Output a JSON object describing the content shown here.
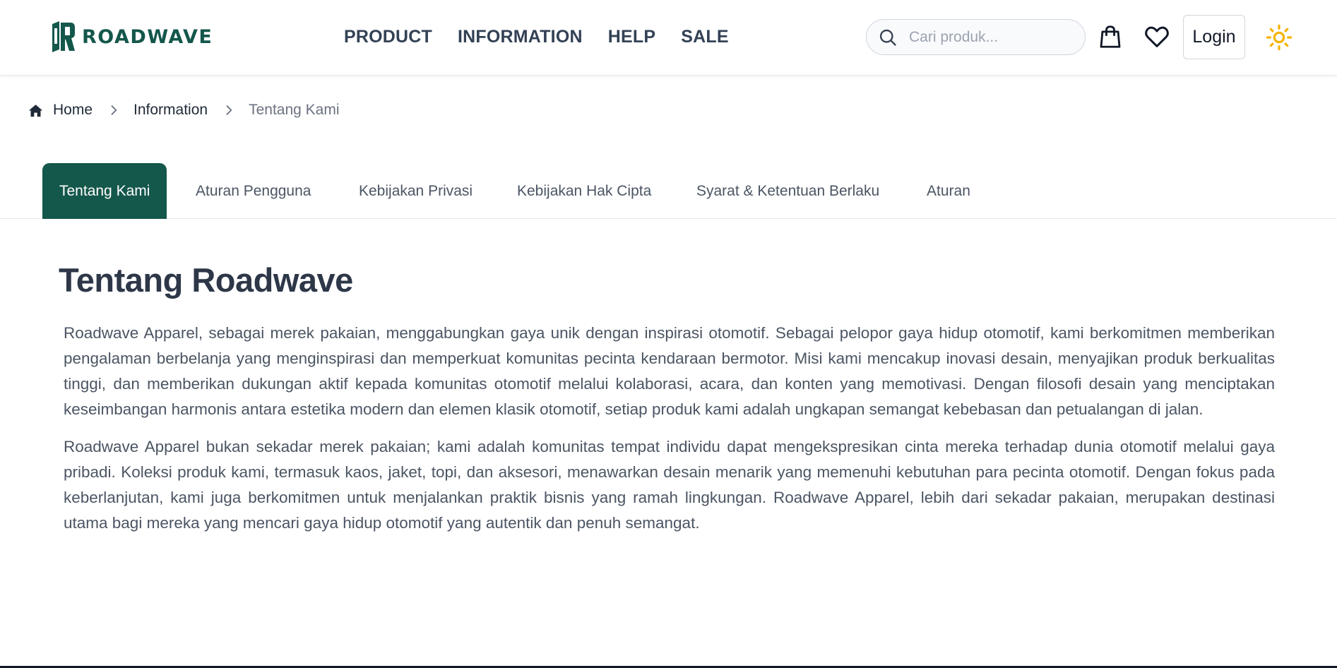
{
  "header": {
    "logo_text": "ROADWAVE",
    "nav": [
      {
        "label": "PRODUCT"
      },
      {
        "label": "INFORMATION"
      },
      {
        "label": "HELP"
      },
      {
        "label": "SALE"
      }
    ],
    "search": {
      "placeholder": "Cari produk..."
    },
    "login_label": "Login",
    "icons": {
      "search": "search-icon",
      "cart": "shopping-bag-icon",
      "wishlist": "heart-icon",
      "theme": "sun-icon"
    },
    "colors": {
      "brand": "#14574b",
      "theme_icon": "#f5b300"
    }
  },
  "breadcrumb": {
    "home": "Home",
    "section": "Information",
    "current": "Tentang Kami"
  },
  "tabs": [
    {
      "label": "Tentang Kami",
      "active": true
    },
    {
      "label": "Aturan Pengguna",
      "active": false
    },
    {
      "label": "Kebijakan Privasi",
      "active": false
    },
    {
      "label": "Kebijakan Hak Cipta",
      "active": false
    },
    {
      "label": "Syarat & Ketentuan Berlaku",
      "active": false
    },
    {
      "label": "Aturan",
      "active": false
    }
  ],
  "content": {
    "title": "Tentang Roadwave",
    "paragraphs": [
      "Roadwave Apparel, sebagai merek pakaian, menggabungkan gaya unik dengan inspirasi otomotif. Sebagai pelopor gaya hidup otomotif, kami berkomitmen memberikan pengalaman berbelanja yang menginspirasi dan memperkuat komunitas pecinta kendaraan bermotor. Misi kami mencakup inovasi desain, menyajikan produk berkualitas tinggi, dan memberikan dukungan aktif kepada komunitas otomotif melalui kolaborasi, acara, dan konten yang memotivasi. Dengan filosofi desain yang menciptakan keseimbangan harmonis antara estetika modern dan elemen klasik otomotif, setiap produk kami adalah ungkapan semangat kebebasan dan petualangan di jalan.",
      "Roadwave Apparel bukan sekadar merek pakaian; kami adalah komunitas tempat individu dapat mengekspresikan cinta mereka terhadap dunia otomotif melalui gaya pribadi. Koleksi produk kami, termasuk kaos, jaket, topi, dan aksesori, menawarkan desain menarik yang memenuhi kebutuhan para pecinta otomotif. Dengan fokus pada keberlanjutan, kami juga berkomitmen untuk menjalankan praktik bisnis yang ramah lingkungan. Roadwave Apparel, lebih dari sekadar pakaian, merupakan destinasi utama bagi mereka yang mencari gaya hidup otomotif yang autentik dan penuh semangat."
    ]
  }
}
